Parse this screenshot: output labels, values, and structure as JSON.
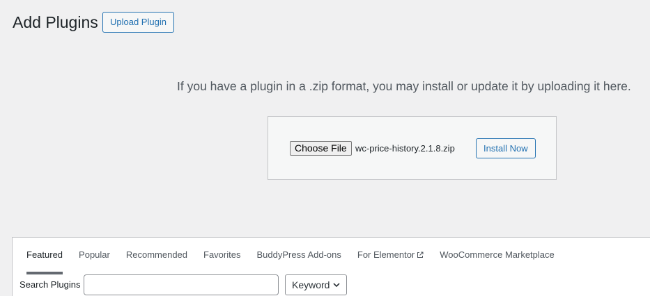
{
  "header": {
    "title": "Add Plugins",
    "upload_button": "Upload Plugin"
  },
  "upload": {
    "help_text": "If you have a plugin in a .zip format, you may install or update it by uploading it here.",
    "choose_file_label": "Choose File",
    "selected_file": "wc-price-history.2.1.8.zip",
    "install_button": "Install Now"
  },
  "filter": {
    "tabs": [
      {
        "label": "Featured",
        "current": true
      },
      {
        "label": "Popular"
      },
      {
        "label": "Recommended"
      },
      {
        "label": "Favorites"
      },
      {
        "label": "BuddyPress Add-ons"
      },
      {
        "label": "For Elementor",
        "icon": "external-link-icon"
      },
      {
        "label": "WooCommerce Marketplace"
      }
    ],
    "search_label": "Search Plugins",
    "search_value": "",
    "search_type_selected": "Keyword"
  },
  "colors": {
    "background": "#f0f0f1",
    "accent": "#2271b1",
    "text": "#1d2327",
    "muted_text": "#50575e"
  }
}
